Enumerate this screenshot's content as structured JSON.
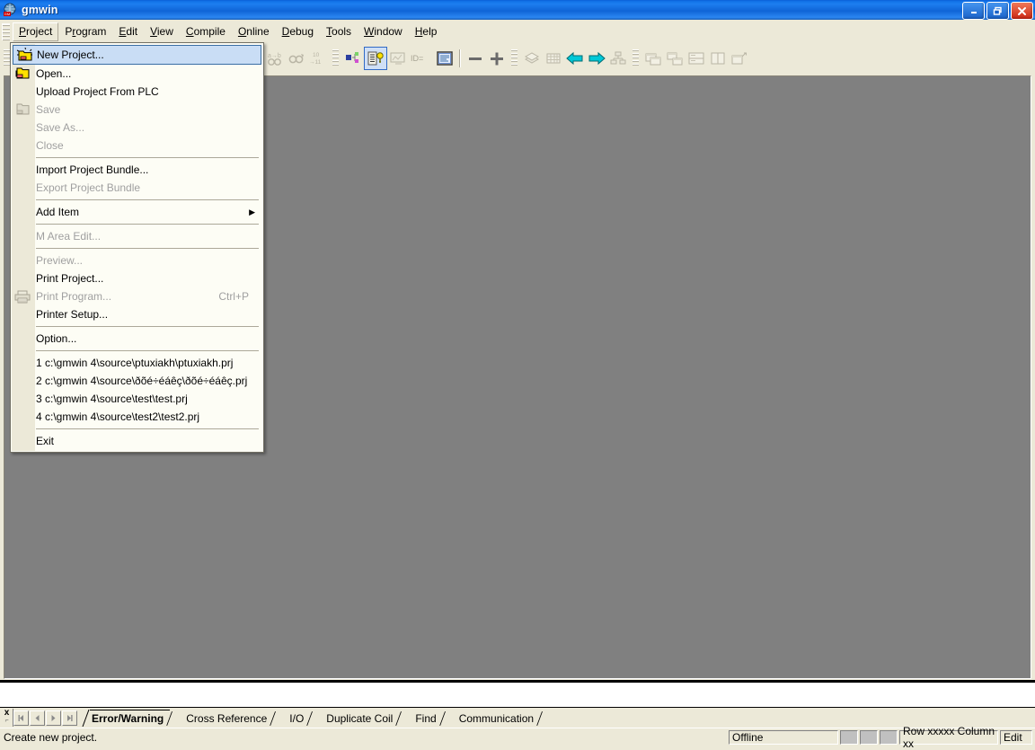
{
  "window": {
    "title": "gmwin",
    "icon": "globe-icon",
    "controls": [
      {
        "name": "minimize-button",
        "glyph": "_"
      },
      {
        "name": "restore-button",
        "glyph": "❐"
      },
      {
        "name": "close-button",
        "glyph": "✕"
      }
    ]
  },
  "menubar": {
    "items": [
      {
        "label": "Project",
        "mnemonic": "P",
        "open": true
      },
      {
        "label": "Program",
        "mnemonic": "r",
        "open": false
      },
      {
        "label": "Edit",
        "mnemonic": "E",
        "open": false
      },
      {
        "label": "View",
        "mnemonic": "V",
        "open": false
      },
      {
        "label": "Compile",
        "mnemonic": "C",
        "open": false
      },
      {
        "label": "Online",
        "mnemonic": "O",
        "open": false
      },
      {
        "label": "Debug",
        "mnemonic": "D",
        "open": false
      },
      {
        "label": "Tools",
        "mnemonic": "T",
        "open": false
      },
      {
        "label": "Window",
        "mnemonic": "W",
        "open": false
      },
      {
        "label": "Help",
        "mnemonic": "H",
        "open": false
      }
    ]
  },
  "project_menu": {
    "items": [
      {
        "label": "New Project...",
        "icon": "new-project-icon",
        "state": "highlighted",
        "accel": "",
        "submenu": false
      },
      {
        "label": "Open...",
        "icon": "open-folder-icon",
        "state": "enabled",
        "accel": "",
        "submenu": false
      },
      {
        "label": "Upload Project From PLC",
        "icon": "",
        "state": "enabled",
        "accel": "",
        "submenu": false
      },
      {
        "label": "Save",
        "icon": "save-icon",
        "state": "disabled",
        "accel": "",
        "submenu": false
      },
      {
        "label": "Save As...",
        "icon": "",
        "state": "disabled",
        "accel": "",
        "submenu": false
      },
      {
        "label": "Close",
        "icon": "",
        "state": "disabled",
        "accel": "",
        "submenu": false
      },
      {
        "separator": true
      },
      {
        "label": "Import Project Bundle...",
        "icon": "",
        "state": "enabled",
        "accel": "",
        "submenu": false
      },
      {
        "label": "Export Project Bundle",
        "icon": "",
        "state": "disabled",
        "accel": "",
        "submenu": false
      },
      {
        "separator": true
      },
      {
        "label": "Add Item",
        "icon": "",
        "state": "enabled",
        "accel": "",
        "submenu": true
      },
      {
        "separator": true
      },
      {
        "label": "M Area Edit...",
        "icon": "",
        "state": "disabled",
        "accel": "",
        "submenu": false
      },
      {
        "separator": true
      },
      {
        "label": "Preview...",
        "icon": "",
        "state": "disabled",
        "accel": "",
        "submenu": false
      },
      {
        "label": "Print Project...",
        "icon": "",
        "state": "enabled",
        "accel": "",
        "submenu": false
      },
      {
        "label": "Print Program...",
        "icon": "printer-icon",
        "state": "disabled",
        "accel": "Ctrl+P",
        "submenu": false
      },
      {
        "label": "Printer Setup...",
        "icon": "",
        "state": "enabled",
        "accel": "",
        "submenu": false
      },
      {
        "separator": true
      },
      {
        "label": "Option...",
        "icon": "",
        "state": "enabled",
        "accel": "",
        "submenu": false
      },
      {
        "separator": true
      },
      {
        "label": "1 c:\\gmwin 4\\source\\ptuxiakh\\ptuxiakh.prj",
        "icon": "",
        "state": "enabled",
        "accel": "",
        "submenu": false
      },
      {
        "label": "2 c:\\gmwin 4\\source\\ðõé÷éáêç\\ðõé÷éáêç.prj",
        "icon": "",
        "state": "enabled",
        "accel": "",
        "submenu": false
      },
      {
        "label": "3 c:\\gmwin 4\\source\\test\\test.prj",
        "icon": "",
        "state": "enabled",
        "accel": "",
        "submenu": false
      },
      {
        "label": "4 c:\\gmwin 4\\source\\test2\\test2.prj",
        "icon": "",
        "state": "enabled",
        "accel": "",
        "submenu": false
      },
      {
        "separator": true
      },
      {
        "label": "Exit",
        "icon": "",
        "state": "enabled",
        "accel": "",
        "submenu": false
      }
    ]
  },
  "toolbar": {
    "groups": [
      {
        "buttons": [
          {
            "name": "new-project-icon",
            "enabled": false,
            "selected": false
          },
          {
            "name": "open-project-icon",
            "enabled": false,
            "selected": false
          },
          {
            "name": "save-project-icon",
            "enabled": false,
            "selected": false
          }
        ]
      },
      {
        "buttons": [
          {
            "name": "undo-icon",
            "enabled": false,
            "selected": false
          },
          {
            "name": "redo-icon",
            "enabled": false,
            "selected": false
          },
          {
            "name": "cut-icon",
            "enabled": false,
            "selected": false
          },
          {
            "name": "copy-icon",
            "enabled": false,
            "selected": false
          },
          {
            "name": "paste-icon",
            "enabled": false,
            "selected": false
          },
          {
            "name": "delete-icon",
            "enabled": false,
            "selected": false
          },
          {
            "name": "find-icon",
            "enabled": false,
            "selected": false
          },
          {
            "name": "find-in-project-icon",
            "enabled": false,
            "selected": false
          },
          {
            "name": "replace-icon",
            "enabled": false,
            "selected": false
          },
          {
            "name": "find-next-icon",
            "enabled": false,
            "selected": false
          },
          {
            "name": "goto-line-icon",
            "enabled": false,
            "selected": false,
            "label": "10→11"
          }
        ]
      },
      {
        "buttons": [
          {
            "name": "project-tree-icon",
            "enabled": true,
            "selected": false
          },
          {
            "name": "variable-list-icon",
            "enabled": true,
            "selected": true
          },
          {
            "name": "monitor-icon",
            "enabled": false,
            "selected": false
          },
          {
            "name": "id-icon",
            "enabled": false,
            "selected": false,
            "label": "ID="
          },
          {
            "name": "message-window-icon",
            "enabled": true,
            "selected": false
          }
        ]
      },
      {
        "buttons": [
          {
            "name": "zoom-out-icon",
            "enabled": true,
            "selected": false
          },
          {
            "name": "zoom-in-icon",
            "enabled": true,
            "selected": false
          }
        ]
      },
      {
        "buttons": [
          {
            "name": "library-icon",
            "enabled": false,
            "selected": false
          },
          {
            "name": "grid-icon",
            "enabled": false,
            "selected": false
          },
          {
            "name": "back-arrow-icon",
            "enabled": true,
            "selected": false
          },
          {
            "name": "forward-arrow-icon",
            "enabled": true,
            "selected": false
          },
          {
            "name": "hierarchy-icon",
            "enabled": false,
            "selected": false
          }
        ]
      },
      {
        "buttons": [
          {
            "name": "cascade-windows-icon",
            "enabled": false,
            "selected": false
          },
          {
            "name": "tile-windows-icon",
            "enabled": false,
            "selected": false
          },
          {
            "name": "tile-horizontal-icon",
            "enabled": false,
            "selected": false
          },
          {
            "name": "tile-vertical-icon",
            "enabled": false,
            "selected": false
          },
          {
            "name": "arrange-icons-icon",
            "enabled": false,
            "selected": false
          }
        ]
      }
    ]
  },
  "output_tabs": {
    "close_glyph": "x",
    "nav": [
      "⏮",
      "◀",
      "▶",
      "⏭"
    ],
    "tabs": [
      {
        "label": "Error/Warning",
        "active": true
      },
      {
        "label": "Cross Reference",
        "active": false
      },
      {
        "label": "I/O",
        "active": false
      },
      {
        "label": "Duplicate Coil",
        "active": false
      },
      {
        "label": "Find",
        "active": false
      },
      {
        "label": "Communication",
        "active": false
      }
    ]
  },
  "statusbar": {
    "message": "Create new project.",
    "connection": "Offline",
    "indicators": [
      "",
      "",
      ""
    ],
    "position": "Row xxxxx Column xx",
    "mode": "Edit"
  },
  "colors": {
    "title_bar": "#0f64d6",
    "face": "#ece9d8",
    "client_area": "#808080",
    "menu_bg": "#fdfdf5",
    "highlight_fill": "#c9ddf5",
    "highlight_border": "#3a6ea5",
    "disabled_text": "#a0a0a0",
    "accent_cyan": "#00c8d7"
  }
}
